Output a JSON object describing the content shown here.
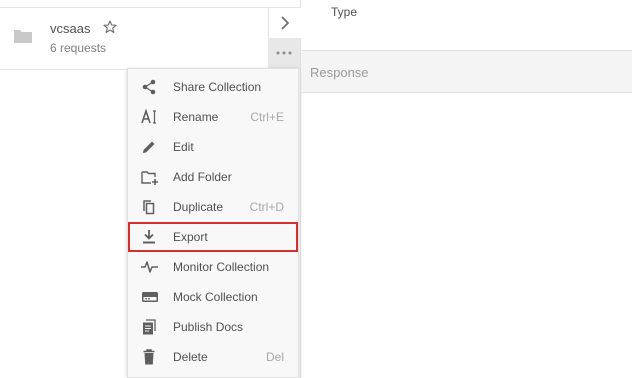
{
  "collection": {
    "name": "vcsaas",
    "count": "6 requests"
  },
  "header": {
    "type_label": "Type"
  },
  "response": {
    "label": "Response"
  },
  "menu": {
    "items": [
      {
        "label": "Share Collection",
        "shortcut": "",
        "icon": "share-icon"
      },
      {
        "label": "Rename",
        "shortcut": "Ctrl+E",
        "icon": "rename-icon"
      },
      {
        "label": "Edit",
        "shortcut": "",
        "icon": "edit-icon"
      },
      {
        "label": "Add Folder",
        "shortcut": "",
        "icon": "add-folder-icon"
      },
      {
        "label": "Duplicate",
        "shortcut": "Ctrl+D",
        "icon": "duplicate-icon"
      },
      {
        "label": "Export",
        "shortcut": "",
        "icon": "export-icon",
        "highlighted": true
      },
      {
        "label": "Monitor Collection",
        "shortcut": "",
        "icon": "monitor-icon"
      },
      {
        "label": "Mock Collection",
        "shortcut": "",
        "icon": "mock-icon"
      },
      {
        "label": "Publish Docs",
        "shortcut": "",
        "icon": "publish-docs-icon"
      },
      {
        "label": "Delete",
        "shortcut": "Del",
        "icon": "delete-icon"
      }
    ]
  },
  "colors": {
    "highlight_border": "#d32f2f",
    "icon_gray": "#5f5f5f"
  }
}
